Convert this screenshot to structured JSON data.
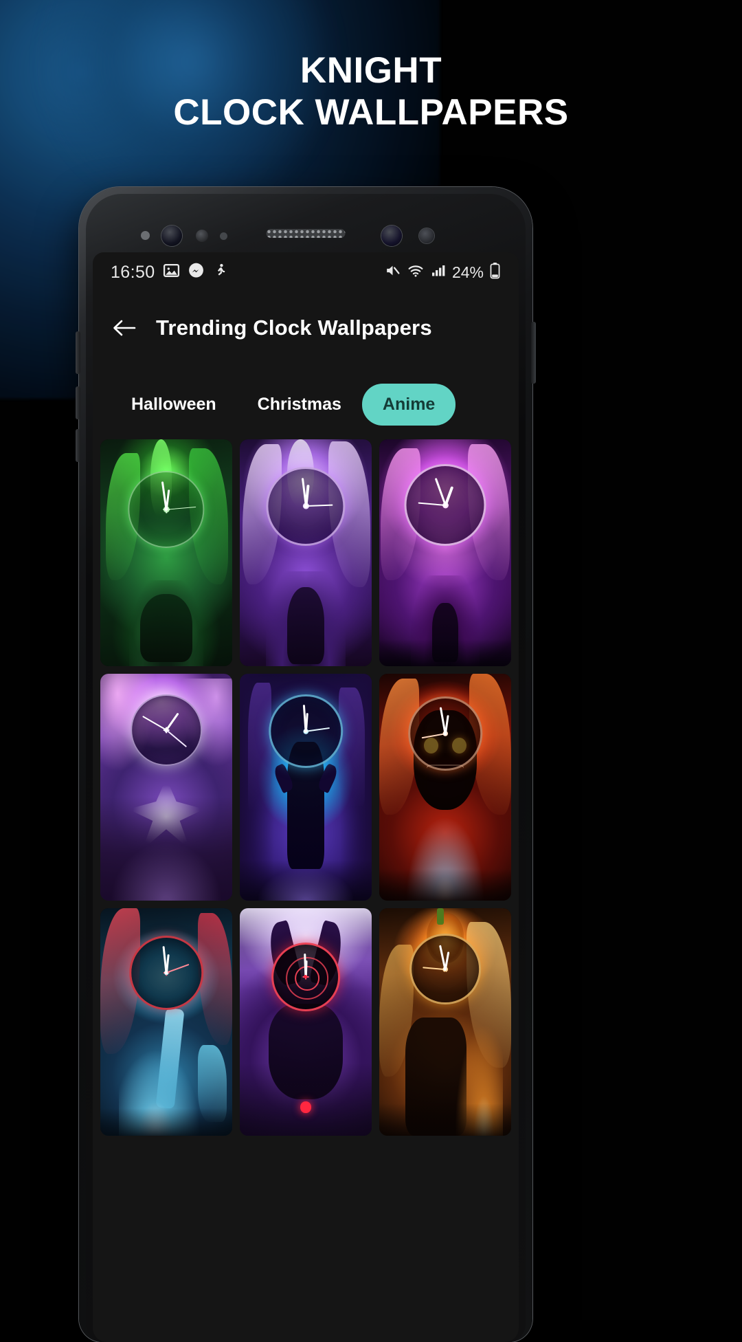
{
  "promo": {
    "headline_line1": "KNIGHT",
    "headline_line2": "CLOCK WALLPAPERS",
    "background_color": "#000000",
    "glow_color": "#1d5f95"
  },
  "phone": {
    "statusbar": {
      "time": "16:50",
      "battery_percent": "24%",
      "left_icons": [
        "image-icon",
        "messenger-icon",
        "running-person-icon"
      ],
      "right_icons": [
        "mute-icon",
        "wifi-icon",
        "signal-icon",
        "battery-icon"
      ]
    },
    "appbar": {
      "back_icon": "back-arrow-icon",
      "title": "Trending Clock Wallpapers"
    },
    "tabs": [
      {
        "label": "Halloween",
        "active": false
      },
      {
        "label": "Christmas",
        "active": false
      },
      {
        "label": "Anime",
        "active": true
      }
    ],
    "accent_color": "#62d4c5",
    "wallpapers": [
      {
        "name": "green-dragon-clock",
        "theme": "green",
        "clock_style": "ticks"
      },
      {
        "name": "purple-dragon-clock",
        "theme": "violet",
        "clock_style": "numerals"
      },
      {
        "name": "magenta-beast-clock",
        "theme": "magenta",
        "clock_style": "numerals"
      },
      {
        "name": "purple-spider-clock",
        "theme": "orchid",
        "clock_style": "ticks"
      },
      {
        "name": "blue-forest-clock",
        "theme": "cyan",
        "clock_style": "numerals"
      },
      {
        "name": "fire-demon-clock",
        "theme": "ember",
        "clock_style": "numerals"
      },
      {
        "name": "ice-maiden-clock",
        "theme": "teal",
        "clock_style": "ticks"
      },
      {
        "name": "red-target-clock",
        "theme": "crimson",
        "clock_style": "target"
      },
      {
        "name": "pumpkin-witch-clock",
        "theme": "amber",
        "clock_style": "numerals"
      }
    ]
  }
}
